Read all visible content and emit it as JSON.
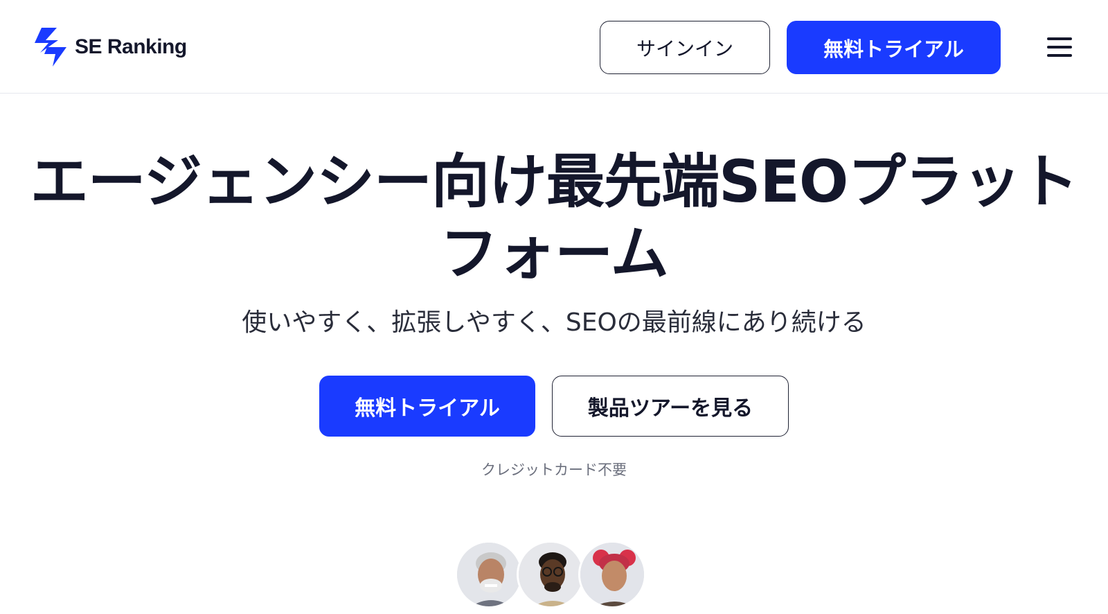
{
  "header": {
    "logo_text": "SE Ranking",
    "signin_label": "サインイン",
    "trial_label": "無料トライアル",
    "menu_icon": "hamburger-menu-icon"
  },
  "hero": {
    "title_line1": "エージェンシー向け最先端SEOプラット",
    "title_line2": "フォーム",
    "subtitle": "使いやすく、拡張しやすく、SEOの最前線にあり続ける",
    "trial_label": "無料トライアル",
    "tour_label": "製品ツアーを見る",
    "note": "クレジットカード不要"
  },
  "avatars": [
    "avatar-older-man",
    "avatar-man-glasses",
    "avatar-woman-red-hair"
  ],
  "colors": {
    "accent": "#1a3bff",
    "text": "#14172b",
    "muted": "#6b6f7d",
    "border": "#e6e8ee"
  }
}
